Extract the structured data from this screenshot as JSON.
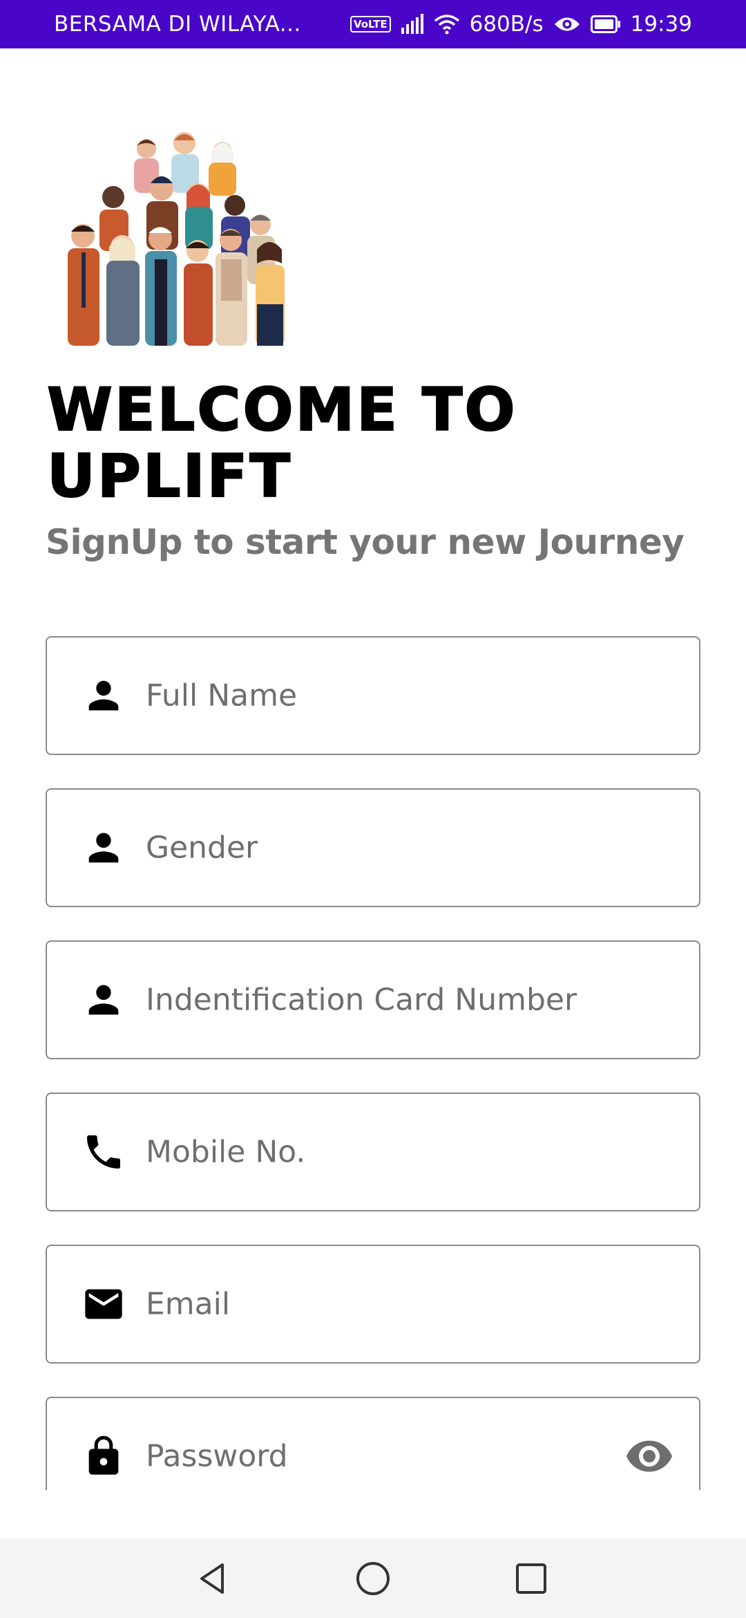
{
  "status_bar": {
    "carrier": "BERSAMA DI WILAYA...",
    "volte": "VoLTE",
    "speed": "680B/s",
    "time": "19:39",
    "background": "#4a06c8",
    "icons": [
      "signal-icon",
      "wifi-icon",
      "eye-icon",
      "battery-icon"
    ]
  },
  "page": {
    "title_line1": "WELCOME TO",
    "title_line2": "UPLIFT",
    "subtitle": "SignUp to start your new Journey"
  },
  "form": {
    "fields": [
      {
        "placeholder": "Full Name",
        "icon": "person-icon"
      },
      {
        "placeholder": "Gender",
        "icon": "person-icon"
      },
      {
        "placeholder": "Indentification Card Number",
        "icon": "person-icon"
      },
      {
        "placeholder": "Mobile No.",
        "icon": "phone-icon"
      },
      {
        "placeholder": "Email",
        "icon": "mail-icon"
      },
      {
        "placeholder": "Password",
        "icon": "lock-icon",
        "toggle_icon": "eye-icon"
      }
    ],
    "border_color": "#8a8a8a",
    "placeholder_color": "#6e6e6e"
  },
  "nav_bar": {
    "buttons": [
      "back-icon",
      "home-icon",
      "recents-icon"
    ]
  }
}
